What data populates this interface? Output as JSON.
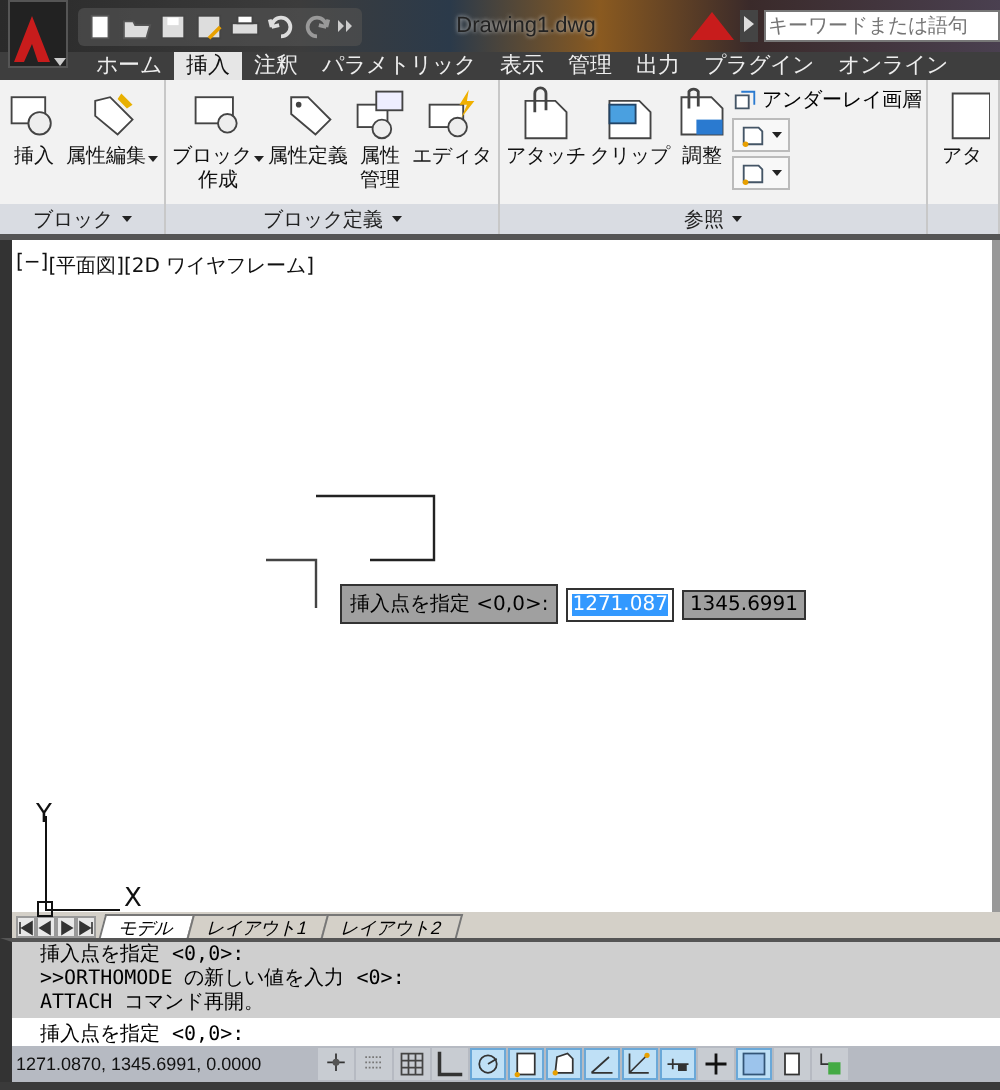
{
  "title_bar": {
    "title": "Drawing1.dwg",
    "search": {
      "placeholder": "キーワードまたは語句"
    }
  },
  "ribbon_tabs": [
    {
      "label": "ホーム",
      "selected": false
    },
    {
      "label": "挿入",
      "selected": true
    },
    {
      "label": "注釈",
      "selected": false
    },
    {
      "label": "パラメトリック",
      "selected": false
    },
    {
      "label": "表示",
      "selected": false
    },
    {
      "label": "管理",
      "selected": false
    },
    {
      "label": "出力",
      "selected": false
    },
    {
      "label": "プラグイン",
      "selected": false
    },
    {
      "label": "オンライン",
      "selected": false
    }
  ],
  "ribbon_panels": [
    {
      "title": "ブロック",
      "buttons": [
        {
          "kind": "large",
          "label_lines": [
            "挿入"
          ],
          "has_menu": false
        },
        {
          "kind": "large",
          "label_lines": [
            "属性編集"
          ],
          "has_menu": true
        }
      ]
    },
    {
      "title": "ブロック定義",
      "buttons": [
        {
          "kind": "large",
          "label_lines": [
            "ブロック",
            "作成"
          ],
          "has_menu": true
        },
        {
          "kind": "large",
          "label_lines": [
            "属性定義"
          ],
          "has_menu": false
        },
        {
          "kind": "large",
          "label_lines": [
            "属性",
            "管理"
          ],
          "has_menu": false
        },
        {
          "kind": "large",
          "label_lines": [
            "エディタ"
          ],
          "has_menu": false
        }
      ]
    },
    {
      "title": "参照",
      "buttons": [
        {
          "kind": "large",
          "label_lines": [
            "アタッチ"
          ],
          "has_menu": false
        },
        {
          "kind": "large",
          "label_lines": [
            "クリップ"
          ],
          "has_menu": false
        },
        {
          "kind": "large",
          "label_lines": [
            "調整"
          ],
          "has_menu": false
        },
        {
          "kind": "small",
          "label_lines": [
            "アンダーレイ画層"
          ],
          "has_menu": false
        },
        {
          "kind": "icon_dropdown",
          "has_menu": true
        },
        {
          "kind": "icon_dropdown",
          "has_menu": true
        }
      ]
    },
    {
      "buttons": [
        {
          "kind": "large",
          "label_lines": [
            "アタ"
          ],
          "has_menu": false
        }
      ]
    }
  ],
  "viewport": {
    "controls": [
      "[−]",
      "[平面図]",
      "[2D ワイヤフレーム]"
    ],
    "dynamic_input": {
      "prompt": "挿入点を指定 <0,0>:",
      "fields": [
        {
          "value": "1271.087",
          "selected": true
        },
        {
          "value": "1345.6991",
          "selected": false
        }
      ]
    },
    "ucs": {
      "y_label": "Y",
      "x_label": "X"
    }
  },
  "layout_tabs": [
    {
      "label": "モデル",
      "selected": true
    },
    {
      "label": "レイアウト1",
      "selected": false
    },
    {
      "label": "レイアウト2",
      "selected": false
    }
  ],
  "command_history": [
    "挿入点を指定 <0,0>:",
    ">>ORTHOMODE の新しい値を入力 <0>:",
    "ATTACH コマンド再開。"
  ],
  "command_line": "挿入点を指定 <0,0>:",
  "status_bar": {
    "coordinates": "1271.0870, 1345.6991, 0.0000",
    "toggles": [
      {
        "on": false
      },
      {
        "on": false
      },
      {
        "on": false
      },
      {
        "on": false
      },
      {
        "on": true
      },
      {
        "on": true
      },
      {
        "on": true
      },
      {
        "on": true
      },
      {
        "on": true
      },
      {
        "on": true
      },
      {
        "on": false
      },
      {
        "on": true
      },
      {
        "on": false
      },
      {
        "on": false
      }
    ]
  }
}
